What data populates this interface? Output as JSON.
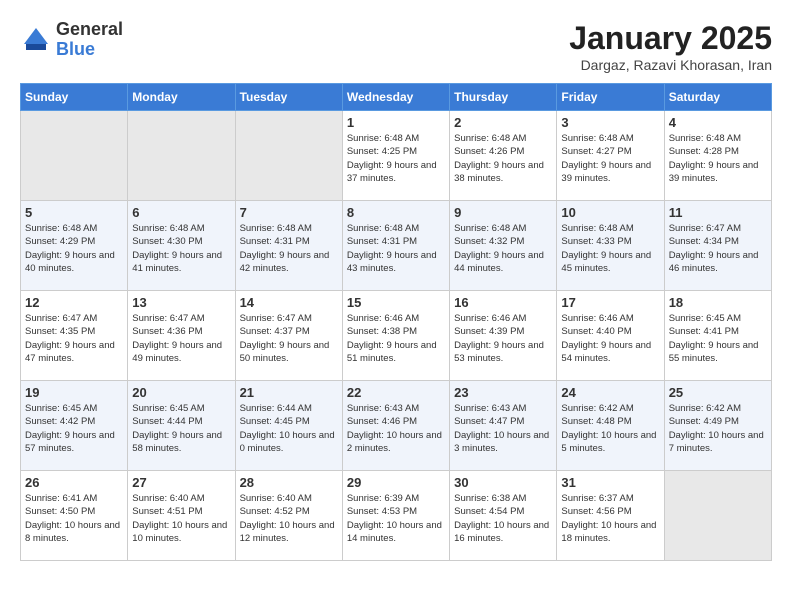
{
  "header": {
    "logo_general": "General",
    "logo_blue": "Blue",
    "month_year": "January 2025",
    "location": "Dargaz, Razavi Khorasan, Iran"
  },
  "calendar": {
    "days_of_week": [
      "Sunday",
      "Monday",
      "Tuesday",
      "Wednesday",
      "Thursday",
      "Friday",
      "Saturday"
    ],
    "weeks": [
      [
        {
          "day": "",
          "info": ""
        },
        {
          "day": "",
          "info": ""
        },
        {
          "day": "",
          "info": ""
        },
        {
          "day": "1",
          "info": "Sunrise: 6:48 AM\nSunset: 4:25 PM\nDaylight: 9 hours and 37 minutes."
        },
        {
          "day": "2",
          "info": "Sunrise: 6:48 AM\nSunset: 4:26 PM\nDaylight: 9 hours and 38 minutes."
        },
        {
          "day": "3",
          "info": "Sunrise: 6:48 AM\nSunset: 4:27 PM\nDaylight: 9 hours and 39 minutes."
        },
        {
          "day": "4",
          "info": "Sunrise: 6:48 AM\nSunset: 4:28 PM\nDaylight: 9 hours and 39 minutes."
        }
      ],
      [
        {
          "day": "5",
          "info": "Sunrise: 6:48 AM\nSunset: 4:29 PM\nDaylight: 9 hours and 40 minutes."
        },
        {
          "day": "6",
          "info": "Sunrise: 6:48 AM\nSunset: 4:30 PM\nDaylight: 9 hours and 41 minutes."
        },
        {
          "day": "7",
          "info": "Sunrise: 6:48 AM\nSunset: 4:31 PM\nDaylight: 9 hours and 42 minutes."
        },
        {
          "day": "8",
          "info": "Sunrise: 6:48 AM\nSunset: 4:31 PM\nDaylight: 9 hours and 43 minutes."
        },
        {
          "day": "9",
          "info": "Sunrise: 6:48 AM\nSunset: 4:32 PM\nDaylight: 9 hours and 44 minutes."
        },
        {
          "day": "10",
          "info": "Sunrise: 6:48 AM\nSunset: 4:33 PM\nDaylight: 9 hours and 45 minutes."
        },
        {
          "day": "11",
          "info": "Sunrise: 6:47 AM\nSunset: 4:34 PM\nDaylight: 9 hours and 46 minutes."
        }
      ],
      [
        {
          "day": "12",
          "info": "Sunrise: 6:47 AM\nSunset: 4:35 PM\nDaylight: 9 hours and 47 minutes."
        },
        {
          "day": "13",
          "info": "Sunrise: 6:47 AM\nSunset: 4:36 PM\nDaylight: 9 hours and 49 minutes."
        },
        {
          "day": "14",
          "info": "Sunrise: 6:47 AM\nSunset: 4:37 PM\nDaylight: 9 hours and 50 minutes."
        },
        {
          "day": "15",
          "info": "Sunrise: 6:46 AM\nSunset: 4:38 PM\nDaylight: 9 hours and 51 minutes."
        },
        {
          "day": "16",
          "info": "Sunrise: 6:46 AM\nSunset: 4:39 PM\nDaylight: 9 hours and 53 minutes."
        },
        {
          "day": "17",
          "info": "Sunrise: 6:46 AM\nSunset: 4:40 PM\nDaylight: 9 hours and 54 minutes."
        },
        {
          "day": "18",
          "info": "Sunrise: 6:45 AM\nSunset: 4:41 PM\nDaylight: 9 hours and 55 minutes."
        }
      ],
      [
        {
          "day": "19",
          "info": "Sunrise: 6:45 AM\nSunset: 4:42 PM\nDaylight: 9 hours and 57 minutes."
        },
        {
          "day": "20",
          "info": "Sunrise: 6:45 AM\nSunset: 4:44 PM\nDaylight: 9 hours and 58 minutes."
        },
        {
          "day": "21",
          "info": "Sunrise: 6:44 AM\nSunset: 4:45 PM\nDaylight: 10 hours and 0 minutes."
        },
        {
          "day": "22",
          "info": "Sunrise: 6:43 AM\nSunset: 4:46 PM\nDaylight: 10 hours and 2 minutes."
        },
        {
          "day": "23",
          "info": "Sunrise: 6:43 AM\nSunset: 4:47 PM\nDaylight: 10 hours and 3 minutes."
        },
        {
          "day": "24",
          "info": "Sunrise: 6:42 AM\nSunset: 4:48 PM\nDaylight: 10 hours and 5 minutes."
        },
        {
          "day": "25",
          "info": "Sunrise: 6:42 AM\nSunset: 4:49 PM\nDaylight: 10 hours and 7 minutes."
        }
      ],
      [
        {
          "day": "26",
          "info": "Sunrise: 6:41 AM\nSunset: 4:50 PM\nDaylight: 10 hours and 8 minutes."
        },
        {
          "day": "27",
          "info": "Sunrise: 6:40 AM\nSunset: 4:51 PM\nDaylight: 10 hours and 10 minutes."
        },
        {
          "day": "28",
          "info": "Sunrise: 6:40 AM\nSunset: 4:52 PM\nDaylight: 10 hours and 12 minutes."
        },
        {
          "day": "29",
          "info": "Sunrise: 6:39 AM\nSunset: 4:53 PM\nDaylight: 10 hours and 14 minutes."
        },
        {
          "day": "30",
          "info": "Sunrise: 6:38 AM\nSunset: 4:54 PM\nDaylight: 10 hours and 16 minutes."
        },
        {
          "day": "31",
          "info": "Sunrise: 6:37 AM\nSunset: 4:56 PM\nDaylight: 10 hours and 18 minutes."
        },
        {
          "day": "",
          "info": ""
        }
      ]
    ]
  }
}
